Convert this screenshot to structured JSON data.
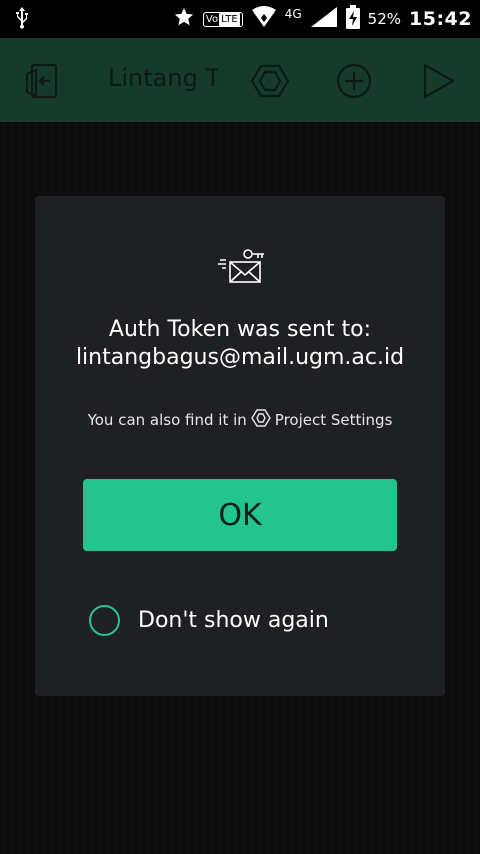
{
  "status_bar": {
    "network": "4G",
    "volte_vo": "Vo",
    "volte_lte": "LTE",
    "battery": "52%",
    "time": "15:42"
  },
  "app_bar": {
    "title": "Lintang T",
    "icons": [
      "exit-icon",
      "hexagon-settings-icon",
      "add-icon",
      "play-icon"
    ]
  },
  "dialog": {
    "title_line1": "Auth Token was sent to:",
    "title_line2": "lintangbagus@mail.ugm.ac.id",
    "hint_prefix": "You can also find it in",
    "hint_link": "Project Settings",
    "ok_label": "OK",
    "dont_show_label": "Don't show again"
  },
  "colors": {
    "accent": "#23c48e",
    "appbar": "#163b2d",
    "dialog": "#1f2023"
  }
}
